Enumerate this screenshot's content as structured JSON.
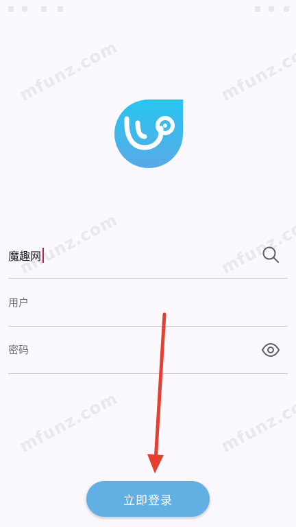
{
  "watermark": {
    "text": "mfunz.com"
  },
  "logo": {
    "icon": "stethoscope-droplet-logo",
    "gradient_top": "#26c6f0",
    "gradient_bottom": "#5aa9e6"
  },
  "search_field": {
    "value": "魔趣网",
    "icon": "search-icon"
  },
  "username_field": {
    "placeholder": "用户"
  },
  "password_field": {
    "placeholder": "密码",
    "icon": "eye-icon"
  },
  "login": {
    "label": "立即登录",
    "color": "#62b0e3"
  },
  "annotation": {
    "color": "#e53f2f"
  }
}
